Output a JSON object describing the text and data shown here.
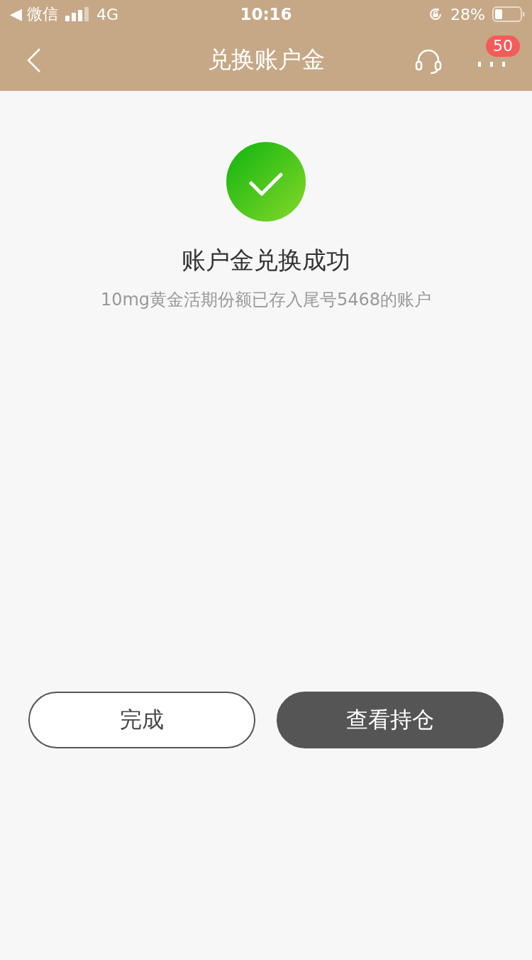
{
  "status_bar": {
    "back_app": "◀ 微信",
    "network": "4G",
    "time": "10:16",
    "battery": "28%"
  },
  "nav": {
    "title": "兑换账户金",
    "badge": "50"
  },
  "result": {
    "title": "账户金兑换成功",
    "message": "10mg黄金活期份额已存入尾号5468的账户"
  },
  "buttons": [
    {
      "label": "完成",
      "kind": "outline"
    },
    {
      "label": "查看持仓",
      "kind": "filled"
    }
  ]
}
